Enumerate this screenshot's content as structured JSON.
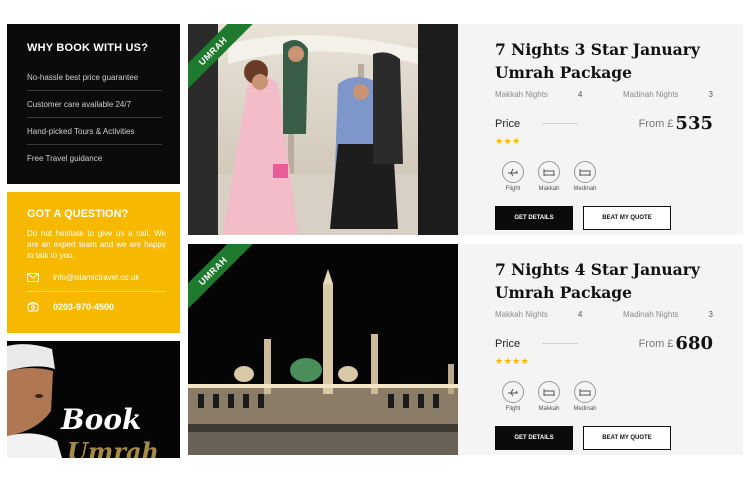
{
  "sidebar": {
    "why": {
      "title": "WHY BOOK WITH US?",
      "items": [
        "No-hassle best price guarantee",
        "Customer care available 24/7",
        "Hand-picked Tours & Activities",
        "Free Travel guidance"
      ]
    },
    "question": {
      "title": "GOT A QUESTION?",
      "text": "Do not hesitate to give us a call. We are an expert team and we are happy to talk to you.",
      "email": "info@islamictravel.co.uk",
      "phone": "0203-970-4500",
      "email_icon": "envelope-icon",
      "phone_icon": "phone-icon"
    },
    "banner": {
      "line1": "Book",
      "line2": "Umrah"
    }
  },
  "packages": [
    {
      "ribbon": "UMRAH",
      "title_line1": "7 Nights 3 Star January",
      "title_line2": "Umrah Package",
      "makkah_label": "Makkah Nights",
      "makkah_nights": "4",
      "madinah_label": "Madinah Nights",
      "madinah_nights": "3",
      "price_label": "Price",
      "from_label": "From £",
      "price": "535",
      "stars": "★★★",
      "star_count": 3,
      "amenities": [
        "Flight",
        "Makkah",
        "Medinah"
      ],
      "btn_details": "GET DETAILS",
      "btn_quote": "BEAT MY QUOTE"
    },
    {
      "ribbon": "UMRAH",
      "title_line1": "7 Nights 4 Star January",
      "title_line2": "Umrah Package",
      "makkah_label": "Makkah Nights",
      "makkah_nights": "4",
      "madinah_label": "Madinah Nights",
      "madinah_nights": "3",
      "price_label": "Price",
      "from_label": "From £",
      "price": "680",
      "stars": "★★★★",
      "star_count": 4,
      "amenities": [
        "Flight",
        "Makkah",
        "Medinah"
      ],
      "btn_details": "GET DETAILS",
      "btn_quote": "BEAT MY QUOTE"
    }
  ],
  "colors": {
    "accent_yellow": "#f6b900",
    "ribbon_green": "#1e7a2d",
    "dark": "#0b0b0b"
  }
}
